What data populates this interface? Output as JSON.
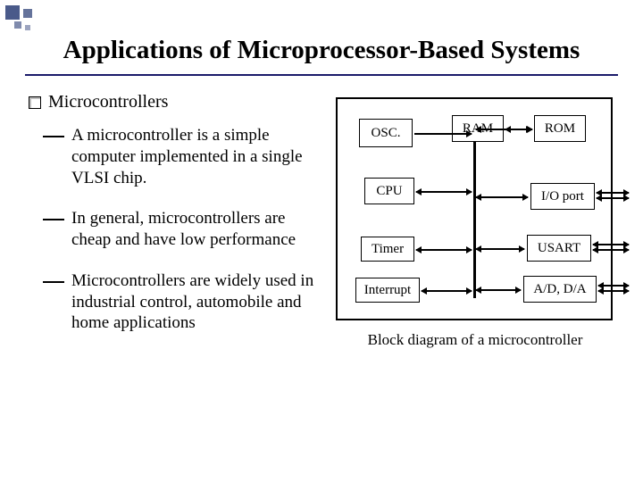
{
  "title": "Applications of Microprocessor-Based Systems",
  "section": "Microcontrollers",
  "bullets": [
    "A microcontroller is a simple computer implemented in a single VLSI chip.",
    "In general, microcontrollers are cheap and have low performance",
    "Microcontrollers are widely used in industrial control, automobile and home applications"
  ],
  "diagram": {
    "blocks": {
      "osc": "OSC.",
      "ram": "RAM",
      "rom": "ROM",
      "cpu": "CPU",
      "io": "I/O port",
      "timer": "Timer",
      "usart": "USART",
      "interrupt": "Interrupt",
      "adda": "A/D, D/A"
    },
    "caption": "Block diagram of a microcontroller"
  }
}
